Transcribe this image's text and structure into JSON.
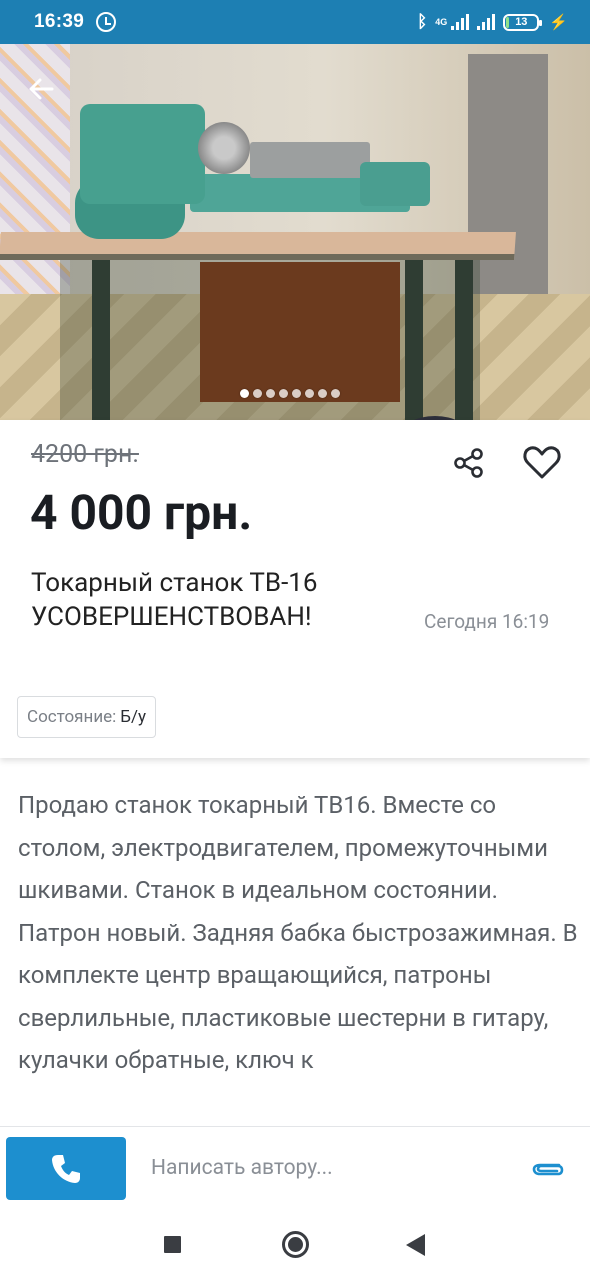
{
  "status_bar": {
    "time": "16:39",
    "network": "4G",
    "battery": "13",
    "icons": [
      "alarm-icon",
      "bluetooth-icon",
      "signal-icon",
      "battery-icon",
      "charging-icon"
    ]
  },
  "gallery": {
    "image_description": "photo of lathe on table",
    "total_images": 8,
    "current_index": 1,
    "back_icon": "arrow-left-icon"
  },
  "listing": {
    "old_price": "4200 грн.",
    "price": "4 000 грн.",
    "title": "Токарный станок ТВ-16 УСОВЕРШЕНСТВОВАН!",
    "date": "Сегодня 16:19",
    "condition_label": "Состояние:",
    "condition_value": "Б/у"
  },
  "description": "Продаю станок токарный ТВ16. Вместе со столом, электродвигателем, промежуточными шкивами. Станок в идеальном состоянии. Патрон новый. Задняя бабка быстрозажимная. В комплекте центр вращающийся, патроны сверлильные, пластиковые шестерни в гитару, кулачки обратные, ключ к",
  "bottom_bar": {
    "message_placeholder": "Написать автору...",
    "call_icon": "phone-icon",
    "attach_icon": "paperclip-icon",
    "accent_color": "#1d8fcf"
  },
  "nav_bar": {
    "icons": [
      "recent-apps-icon",
      "home-icon",
      "back-icon"
    ]
  }
}
